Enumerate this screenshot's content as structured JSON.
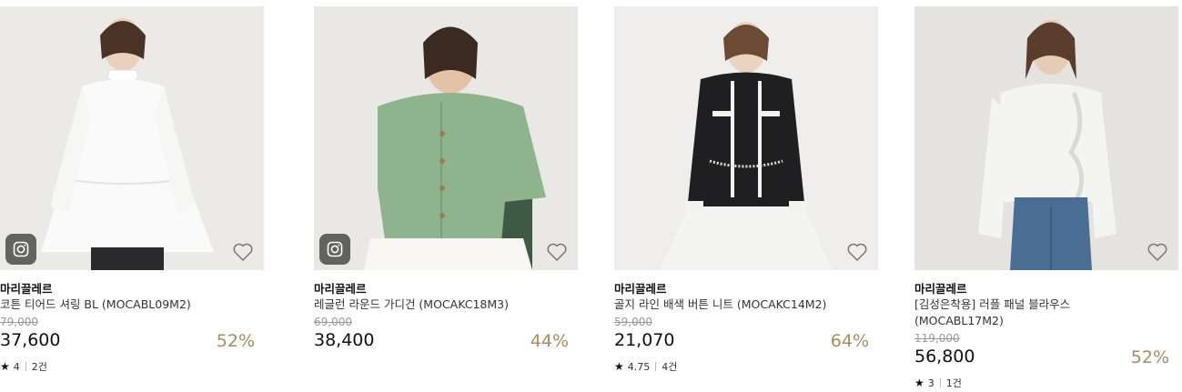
{
  "products": [
    {
      "brand": "마리끌레르",
      "name": "레글런 라운드 가디건 (MOCAKC18M3)",
      "original_price": "69,000",
      "price": "38,400",
      "discount": "44%",
      "rating": null,
      "reviews": null,
      "has_instagram_icon": true,
      "garment_color": "#8fb38c"
    },
    {
      "brand": "마리끌레르",
      "name": "골지 라인 배색 버튼 니트 (MOCAKC14M2)",
      "original_price": "59,000",
      "price": "21,070",
      "discount": "64%",
      "rating": "4.75",
      "reviews": "4건",
      "has_instagram_icon": false,
      "garment_color": "#1f1f22"
    },
    {
      "brand": "마리끌레르",
      "name": "[김성은착용] 러플 패널 블라우스 (MOCABL17M2)",
      "original_price": "119,000",
      "price": "56,800",
      "discount": "52%",
      "rating": "3",
      "reviews": "1건",
      "has_instagram_icon": false,
      "garment_color": "#f4f4f2"
    },
    {
      "brand": "마리끌레르",
      "name": "코튼 티어드 셔링 BL (MOCABL09M2)",
      "original_price": "79,000",
      "price": "37,600",
      "discount": "52%",
      "rating": "4",
      "reviews": "2건",
      "has_instagram_icon": true,
      "garment_color": "#fafafa"
    }
  ],
  "colors": {
    "discount": "#a38e65",
    "original_price": "#999999"
  }
}
